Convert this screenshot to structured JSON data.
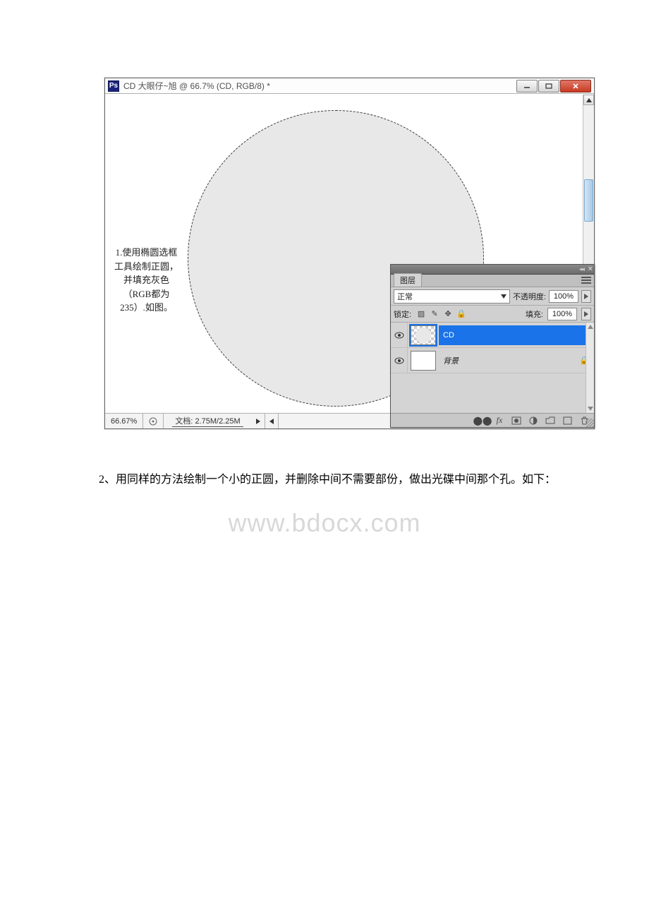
{
  "window": {
    "app_icon_text": "Ps",
    "title": "CD 大眼仔~旭 @ 66.7% (CD, RGB/8) *"
  },
  "status": {
    "zoom": "66.67%",
    "doc_label": "文档:",
    "doc_size": "2.75M/2.25M"
  },
  "annotation": {
    "text": "1.使用椭圆选框工具绘制正圆，并填充灰色（RGB都为235）.如图。"
  },
  "panel": {
    "tab_label": "图层",
    "blend_mode": "正常",
    "opacity_label": "不透明度:",
    "opacity_value": "100%",
    "lock_label": "锁定:",
    "fill_label": "填充:",
    "fill_value": "100%",
    "layers": [
      {
        "name": "CD",
        "bg_italic": false,
        "active": true,
        "locked": false
      },
      {
        "name": "背景",
        "bg_italic": true,
        "active": false,
        "locked": true
      }
    ]
  },
  "watermark": "www.bdocx.com",
  "body_text": "2、用同样的方法绘制一个小的正圆，并删除中间不需要部份，做出光碟中间那个孔。如下：",
  "icons": {
    "link": "⛓",
    "fx": "fx",
    "mask": "◐",
    "adj": "◕",
    "group": "▭",
    "new": "◫",
    "trash": "🗑"
  }
}
